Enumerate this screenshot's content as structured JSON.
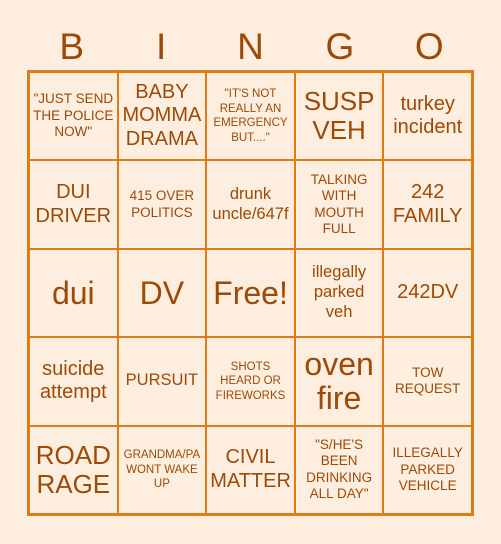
{
  "card": {
    "title": "BINGO",
    "colors": {
      "page_background": "#fdeee0",
      "cell_background": "#fdeee0",
      "border": "#e07b16",
      "text": "#9c4a06"
    }
  },
  "header": {
    "letters": [
      "B",
      "I",
      "N",
      "G",
      "O"
    ]
  },
  "grid": {
    "rows": 5,
    "columns": 5,
    "cells": [
      {
        "text": "\"JUST SEND THE POLICE NOW\"",
        "size": "sm",
        "free": false
      },
      {
        "text": "BABY MOMMA DRAMA",
        "size": "lg",
        "free": false
      },
      {
        "text": "\"IT'S NOT REALLY AN EMERGENCY BUT....\"",
        "size": "xs",
        "free": false
      },
      {
        "text": "SUSP VEH",
        "size": "xl",
        "free": false
      },
      {
        "text": "turkey incident",
        "size": "lg",
        "free": false
      },
      {
        "text": "DUI DRIVER",
        "size": "lg",
        "free": false
      },
      {
        "text": "415 OVER POLITICS",
        "size": "sm",
        "free": false
      },
      {
        "text": "drunk uncle/647f",
        "size": "md",
        "free": false
      },
      {
        "text": "TALKING WITH MOUTH FULL",
        "size": "sm",
        "free": false
      },
      {
        "text": "242 FAMILY",
        "size": "lg",
        "free": false
      },
      {
        "text": "dui",
        "size": "xxl",
        "free": false
      },
      {
        "text": "DV",
        "size": "xxl",
        "free": false
      },
      {
        "text": "Free!",
        "size": "xxl",
        "free": true
      },
      {
        "text": "illegally parked veh",
        "size": "md",
        "free": false
      },
      {
        "text": "242DV",
        "size": "lg",
        "free": false
      },
      {
        "text": "suicide attempt",
        "size": "lg",
        "free": false
      },
      {
        "text": "PURSUIT",
        "size": "md",
        "free": false
      },
      {
        "text": "SHOTS HEARD OR FIREWORKS",
        "size": "xs",
        "free": false
      },
      {
        "text": "oven fire",
        "size": "xxl",
        "free": false
      },
      {
        "text": "TOW REQUEST",
        "size": "sm",
        "free": false
      },
      {
        "text": "ROAD RAGE",
        "size": "xl",
        "free": false
      },
      {
        "text": "GRANDMA/PA WONT WAKE UP",
        "size": "xs",
        "free": false
      },
      {
        "text": "CIVIL MATTER",
        "size": "lg",
        "free": false
      },
      {
        "text": "\"S/HE'S BEEN DRINKING ALL DAY\"",
        "size": "sm",
        "free": false
      },
      {
        "text": "ILLEGALLY PARKED VEHICLE",
        "size": "sm",
        "free": false
      }
    ]
  }
}
